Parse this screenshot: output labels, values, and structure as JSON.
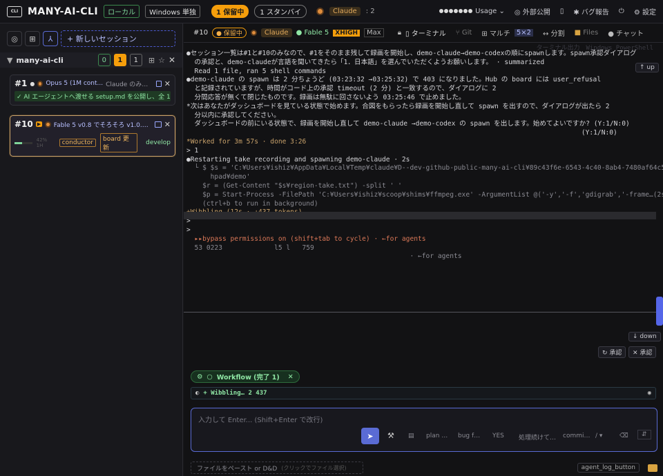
{
  "topbar": {
    "logo_text": "CLI",
    "brand": "MANY-AI-CLI",
    "env_tag": "ローカル",
    "os_tag": "Windows 単独",
    "hold_pill": "1 保留中",
    "standby_pill": "1 スタンバイ",
    "claude_label": "Claude",
    "claude_count": ": 2",
    "usage_label": "Usage",
    "external_label": "外部公開",
    "bug_label": "バグ報告",
    "settings_label": "設定"
  },
  "sidebar": {
    "new_session": "+ 新しいセッション",
    "group": {
      "name": "many-ai-cli",
      "counts": [
        "0",
        "1",
        "1"
      ]
    },
    "sessions": [
      {
        "num": "#1",
        "model": "Opus 5 (1M cont...",
        "title": "Claude のみってな...",
        "status": "✓ AI エージェントへ渡せる setup.md を公開し、全 18 個のコ"
      },
      {
        "num": "#10",
        "model": "Fable 5 v0.8 でそろそろ v1.0.0 が見",
        "progress": "42% 1H",
        "tags": [
          "conductor",
          "board 更新"
        ],
        "branch": "develop"
      }
    ]
  },
  "tabbar": {
    "num": "#10",
    "hold": "保留中",
    "agent": "Claude",
    "model": "Fable 5",
    "effort": "XHIGH",
    "max": "Max",
    "tabs": [
      "ターミナル",
      "Git",
      "マルチ",
      "5×2",
      "分割",
      "Files",
      "チャット"
    ]
  },
  "terminal": {
    "faded_top": "ターミナル出力　Windows PowerShell",
    "lines": [
      "●セッション一覧は#1と#10のみなので、#1をそのまま残して録画を開始し、demo-claude→demo-codexの順にspawnします。spawn承認ダイアログ",
      "  の承認と、demo-claudeが言語を聞いてきたら「1．日本語」を選んでいただくようお願いします。 · summarized",
      "",
      "  Read 1 file, ran 5 shell commands",
      "",
      "●demo-claude の spawn は 2 分ちょうど (03:23:32 →03:25:32) で 403 になりました。Hub の board には user_refusal",
      "  と記録されていますが、時間がコード上の承認 timeout (2 分) と一致するので、ダイアログに 2",
      "  分間応答が無くて閉じたものです。録画は無駄に回さないよう 03:25:46 で止めました。",
      "",
      "",
      "*次はあなたがダッシュボードを見ている状態で始めます。合図をもらったら録画を開始し直して spawn を出すので、ダイアログが出たら 2",
      "  分以内に承認してください。",
      "",
      "",
      "  ダッシュボードの前にいる状態で、録画を開始し直して demo-claude →demo-codex の spawn を出します。始めてよいですか? (Y:1/N:0)",
      "                                                                                                   (Y:1/N:0)",
      "",
      "*Worked for 3m 57s · done 3:26",
      "",
      "",
      "> 1",
      "",
      "●Restarting take recording and spawning demo-claude · 2s",
      "  └ $ $s = 'C:¥Users¥ishiz¥AppData¥Local¥Temp¥claude¥D--dev-github-public-many-ai-cli¥89c43f6e-6543-4c40-8ab4-7480af64c5ac¥scratc",
      "      hpad¥demo'",
      "    $r = (Get-Content \"$s¥region-take.txt\") -split ' '",
      "    $p = Start-Process -FilePath 'C:¥Users¥ishiz¥scoop¥shims¥ffmpeg.exe' -ArgumentList @('-y','-f','gdigrab','-frame…(2s)",
      "    (ctrl+b to run in background)",
      "",
      "+Wibbling…(12s · ↓437 tokens)",
      ">",
      "",
      "",
      ">",
      "  ▸▸bypass permissions on (shift+tab to cycle) · ←for agents",
      "  53 0223             l5 l   759",
      "                                                        · ←for agents"
    ],
    "btn_up": "↑ up",
    "btn_down": "↓ down",
    "btn_approve": "↻ 承認",
    "btn_reject": "✕ 承認"
  },
  "workflow": {
    "label": "Workflow (完了 1)",
    "wibbling": "+ Wibbling… 2 437"
  },
  "input": {
    "placeholder": "入力して Enter... (Shift+Enter で改行)",
    "quick_actions": [
      "plan …",
      "bug f…",
      "YES",
      "処理続けて…",
      "commi…",
      "/ ▾"
    ]
  },
  "bottom": {
    "dropzone": "ファイルをペースト or D&D",
    "dropzone_hint": "(クリックでファイル選択)",
    "log_button": "agent_log_button"
  }
}
